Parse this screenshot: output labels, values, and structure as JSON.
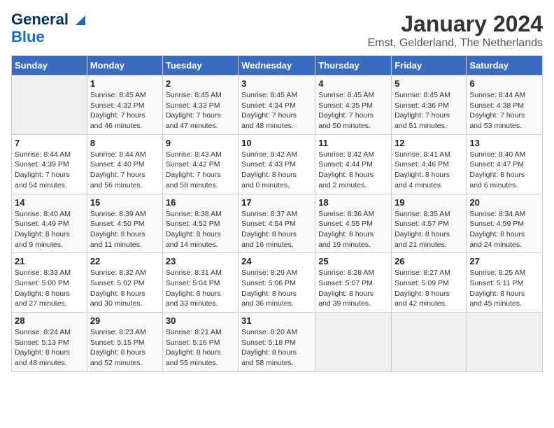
{
  "header": {
    "logo_line1": "General",
    "logo_line2": "Blue",
    "month": "January 2024",
    "location": "Emst, Gelderland, The Netherlands"
  },
  "weekdays": [
    "Sunday",
    "Monday",
    "Tuesday",
    "Wednesday",
    "Thursday",
    "Friday",
    "Saturday"
  ],
  "weeks": [
    [
      {
        "day": "",
        "info": ""
      },
      {
        "day": "1",
        "info": "Sunrise: 8:45 AM\nSunset: 4:32 PM\nDaylight: 7 hours\nand 46 minutes."
      },
      {
        "day": "2",
        "info": "Sunrise: 8:45 AM\nSunset: 4:33 PM\nDaylight: 7 hours\nand 47 minutes."
      },
      {
        "day": "3",
        "info": "Sunrise: 8:45 AM\nSunset: 4:34 PM\nDaylight: 7 hours\nand 48 minutes."
      },
      {
        "day": "4",
        "info": "Sunrise: 8:45 AM\nSunset: 4:35 PM\nDaylight: 7 hours\nand 50 minutes."
      },
      {
        "day": "5",
        "info": "Sunrise: 8:45 AM\nSunset: 4:36 PM\nDaylight: 7 hours\nand 51 minutes."
      },
      {
        "day": "6",
        "info": "Sunrise: 8:44 AM\nSunset: 4:38 PM\nDaylight: 7 hours\nand 53 minutes."
      }
    ],
    [
      {
        "day": "7",
        "info": "Sunrise: 8:44 AM\nSunset: 4:39 PM\nDaylight: 7 hours\nand 54 minutes."
      },
      {
        "day": "8",
        "info": "Sunrise: 8:44 AM\nSunset: 4:40 PM\nDaylight: 7 hours\nand 56 minutes."
      },
      {
        "day": "9",
        "info": "Sunrise: 8:43 AM\nSunset: 4:42 PM\nDaylight: 7 hours\nand 58 minutes."
      },
      {
        "day": "10",
        "info": "Sunrise: 8:42 AM\nSunset: 4:43 PM\nDaylight: 8 hours\nand 0 minutes."
      },
      {
        "day": "11",
        "info": "Sunrise: 8:42 AM\nSunset: 4:44 PM\nDaylight: 8 hours\nand 2 minutes."
      },
      {
        "day": "12",
        "info": "Sunrise: 8:41 AM\nSunset: 4:46 PM\nDaylight: 8 hours\nand 4 minutes."
      },
      {
        "day": "13",
        "info": "Sunrise: 8:40 AM\nSunset: 4:47 PM\nDaylight: 8 hours\nand 6 minutes."
      }
    ],
    [
      {
        "day": "14",
        "info": "Sunrise: 8:40 AM\nSunset: 4:49 PM\nDaylight: 8 hours\nand 9 minutes."
      },
      {
        "day": "15",
        "info": "Sunrise: 8:39 AM\nSunset: 4:50 PM\nDaylight: 8 hours\nand 11 minutes."
      },
      {
        "day": "16",
        "info": "Sunrise: 8:38 AM\nSunset: 4:52 PM\nDaylight: 8 hours\nand 14 minutes."
      },
      {
        "day": "17",
        "info": "Sunrise: 8:37 AM\nSunset: 4:54 PM\nDaylight: 8 hours\nand 16 minutes."
      },
      {
        "day": "18",
        "info": "Sunrise: 8:36 AM\nSunset: 4:55 PM\nDaylight: 8 hours\nand 19 minutes."
      },
      {
        "day": "19",
        "info": "Sunrise: 8:35 AM\nSunset: 4:57 PM\nDaylight: 8 hours\nand 21 minutes."
      },
      {
        "day": "20",
        "info": "Sunrise: 8:34 AM\nSunset: 4:59 PM\nDaylight: 8 hours\nand 24 minutes."
      }
    ],
    [
      {
        "day": "21",
        "info": "Sunrise: 8:33 AM\nSunset: 5:00 PM\nDaylight: 8 hours\nand 27 minutes."
      },
      {
        "day": "22",
        "info": "Sunrise: 8:32 AM\nSunset: 5:02 PM\nDaylight: 8 hours\nand 30 minutes."
      },
      {
        "day": "23",
        "info": "Sunrise: 8:31 AM\nSunset: 5:04 PM\nDaylight: 8 hours\nand 33 minutes."
      },
      {
        "day": "24",
        "info": "Sunrise: 8:29 AM\nSunset: 5:06 PM\nDaylight: 8 hours\nand 36 minutes."
      },
      {
        "day": "25",
        "info": "Sunrise: 8:28 AM\nSunset: 5:07 PM\nDaylight: 8 hours\nand 39 minutes."
      },
      {
        "day": "26",
        "info": "Sunrise: 8:27 AM\nSunset: 5:09 PM\nDaylight: 8 hours\nand 42 minutes."
      },
      {
        "day": "27",
        "info": "Sunrise: 8:25 AM\nSunset: 5:11 PM\nDaylight: 8 hours\nand 45 minutes."
      }
    ],
    [
      {
        "day": "28",
        "info": "Sunrise: 8:24 AM\nSunset: 5:13 PM\nDaylight: 8 hours\nand 48 minutes."
      },
      {
        "day": "29",
        "info": "Sunrise: 8:23 AM\nSunset: 5:15 PM\nDaylight: 8 hours\nand 52 minutes."
      },
      {
        "day": "30",
        "info": "Sunrise: 8:21 AM\nSunset: 5:16 PM\nDaylight: 8 hours\nand 55 minutes."
      },
      {
        "day": "31",
        "info": "Sunrise: 8:20 AM\nSunset: 5:18 PM\nDaylight: 8 hours\nand 58 minutes."
      },
      {
        "day": "",
        "info": ""
      },
      {
        "day": "",
        "info": ""
      },
      {
        "day": "",
        "info": ""
      }
    ]
  ]
}
